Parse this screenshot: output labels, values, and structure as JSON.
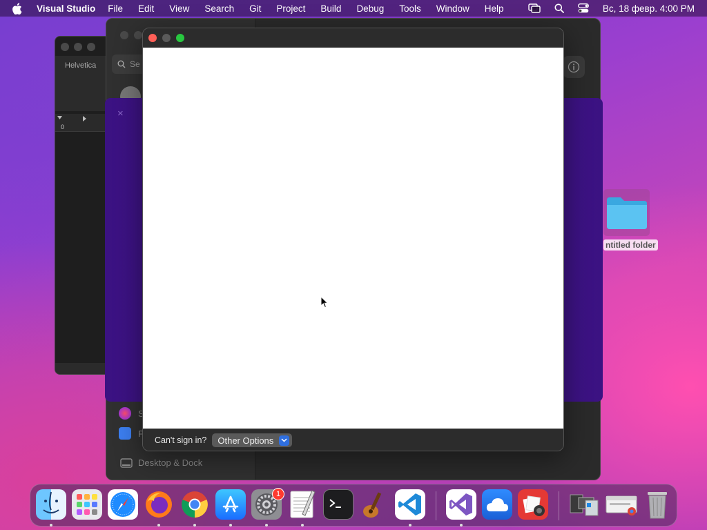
{
  "menubar": {
    "app_name": "Visual Studio",
    "items": [
      "File",
      "Edit",
      "View",
      "Search",
      "Git",
      "Project",
      "Build",
      "Debug",
      "Tools",
      "Window",
      "Help"
    ],
    "clock": "Вс, 18 февр.  4:00 PM",
    "status_icons": [
      "screen-mirroring-icon",
      "spotlight-search-icon",
      "control-center-icon"
    ]
  },
  "background_windows": {
    "textedit": {
      "font_label": "Helvetica",
      "ruler_zero": "0"
    },
    "settings": {
      "search_placeholder": "Se",
      "sidebar_rows": [
        "S",
        "P"
      ],
      "desktop_dock_label": "Desktop & Dock"
    },
    "purple_panel": {
      "close_glyph": "×"
    }
  },
  "desktop": {
    "folder_label": "ntitled folder"
  },
  "sign_in_window": {
    "footer": {
      "cant_sign_in": "Can't sign in?",
      "options_label": "Other Options"
    }
  },
  "dock": {
    "apps": [
      {
        "name": "Finder",
        "icon": "finder-icon",
        "running": true
      },
      {
        "name": "Launchpad",
        "icon": "launchpad-icon",
        "running": false
      },
      {
        "name": "Safari",
        "icon": "safari-icon",
        "running": false
      },
      {
        "name": "Firefox",
        "icon": "firefox-icon",
        "running": true
      },
      {
        "name": "Google Chrome",
        "icon": "chrome-icon",
        "running": true
      },
      {
        "name": "App Store",
        "icon": "app-store-icon",
        "running": true
      },
      {
        "name": "System Settings",
        "icon": "system-settings-icon",
        "running": true,
        "badge": "1"
      },
      {
        "name": "TextEdit",
        "icon": "textedit-icon",
        "running": true
      },
      {
        "name": "Terminal",
        "icon": "terminal-icon",
        "running": false
      },
      {
        "name": "Instruments",
        "icon": "instruments-icon",
        "running": false
      },
      {
        "name": "Visual Studio Code",
        "icon": "vscode-icon",
        "running": true
      },
      {
        "name": "Visual Studio",
        "icon": "visual-studio-icon",
        "running": true
      },
      {
        "name": "Weather",
        "icon": "weather-icon",
        "running": false
      },
      {
        "name": "Photo Booth",
        "icon": "photo-booth-icon",
        "running": false
      },
      {
        "name": "Downloads",
        "icon": "downloads-stack-icon",
        "running": false
      },
      {
        "name": "Chrome Window",
        "icon": "chrome-window-icon",
        "running": false
      },
      {
        "name": "Trash",
        "icon": "trash-icon",
        "running": false
      }
    ]
  }
}
